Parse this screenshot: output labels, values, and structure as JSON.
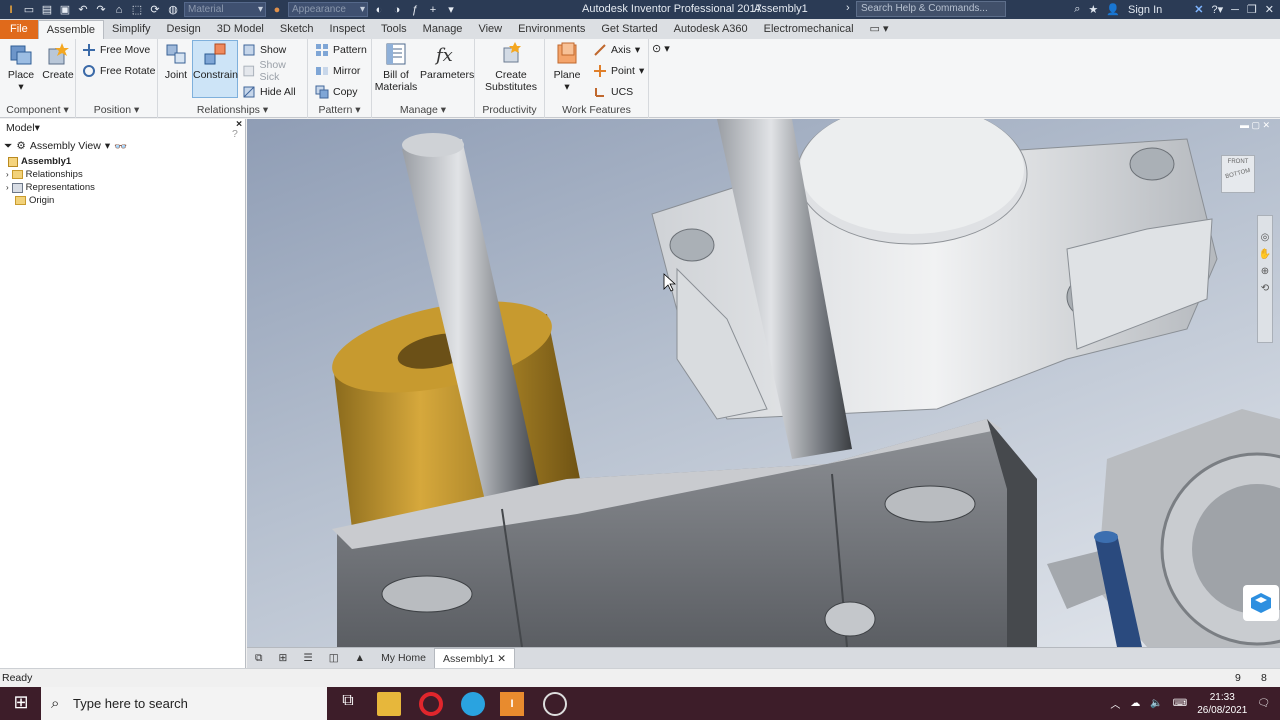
{
  "app": {
    "title": "Autodesk Inventor Professional 2017",
    "document": "Assembly1",
    "material_placeholder": "Material",
    "appearance_placeholder": "Appearance",
    "search_placeholder": "Search Help & Commands...",
    "sign_in": "Sign In"
  },
  "tabs": [
    "File",
    "Assemble",
    "Simplify",
    "Design",
    "3D Model",
    "Sketch",
    "Inspect",
    "Tools",
    "Manage",
    "View",
    "Environments",
    "Get Started",
    "Autodesk A360",
    "Electromechanical"
  ],
  "ribbon": {
    "component": {
      "title": "Component",
      "place": "Place",
      "create": "Create"
    },
    "position": {
      "title": "Position",
      "free_move": "Free Move",
      "free_rotate": "Free Rotate"
    },
    "relationships": {
      "title": "Relationships",
      "joint": "Joint",
      "constrain": "Constrain",
      "show": "Show",
      "show_sick": "Show Sick",
      "hide_all": "Hide All"
    },
    "pattern": {
      "title": "Pattern",
      "pattern": "Pattern",
      "mirror": "Mirror",
      "copy": "Copy"
    },
    "manage": {
      "title": "Manage",
      "bom_line1": "Bill of",
      "bom_line2": "Materials",
      "parameters": "Parameters"
    },
    "productivity": {
      "title": "Productivity",
      "line1": "Create",
      "line2": "Substitutes"
    },
    "work_features": {
      "title": "Work Features",
      "plane": "Plane",
      "axis": "Axis",
      "point": "Point",
      "ucs": "UCS"
    }
  },
  "browser": {
    "title": "Model",
    "view": "Assembly View",
    "root": "Assembly1",
    "items": [
      "Relationships",
      "Representations",
      "Origin"
    ]
  },
  "viewcube": {
    "front": "FRONT",
    "bottom": "BOTTOM"
  },
  "doctabs": {
    "home": "My Home",
    "active": "Assembly1"
  },
  "status": {
    "text": "Ready",
    "count1": "9",
    "count2": "8"
  },
  "taskbar": {
    "search": "Type here to search",
    "time": "21:33",
    "date": "26/08/2021"
  }
}
